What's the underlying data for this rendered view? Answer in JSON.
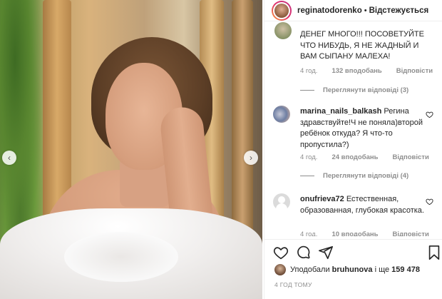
{
  "post": {
    "image_alt_icons": {
      "prev": "chevron-left-icon",
      "next": "chevron-right-icon"
    }
  },
  "header": {
    "username": "reginatodorenko",
    "separator": "•",
    "follow_state": "Відстежується"
  },
  "comments": [
    {
      "author": "",
      "text": "ДЕНЕГ МНОГО!!! ПОСОВЕТУЙТЕ ЧТО НИБУДЬ, Я НЕ ЖАДНЫЙ И ВАМ СЫПАНУ МАЛЕХА!",
      "time": "4 год.",
      "likes": "132 вподобань",
      "reply": "Відповісти",
      "view_replies": "Переглянути відповіді (3)"
    },
    {
      "author": "marina_nails_balkash",
      "text": "Регина здравствуйте!Ч не поняла)второй ребёнок откуда? Я что-то пропустила?)",
      "time": "4 год.",
      "likes": "24 вподобань",
      "reply": "Відповісти",
      "view_replies": "Переглянути відповіді (4)"
    },
    {
      "author": "onufrieva72",
      "text": "Естественная, образованная, глубокая красотка.",
      "time": "4 год.",
      "likes": "10 вподобань",
      "reply": "Відповісти"
    }
  ],
  "likes_line": {
    "prefix": "Уподобали",
    "user": "bruhunova",
    "connector": "і ще",
    "count": "159 478"
  },
  "timestamp": "4 ГОД ТОМУ",
  "icons": {
    "heart": "heart-icon",
    "comment": "comment-icon",
    "share": "share-icon",
    "save": "bookmark-icon"
  }
}
